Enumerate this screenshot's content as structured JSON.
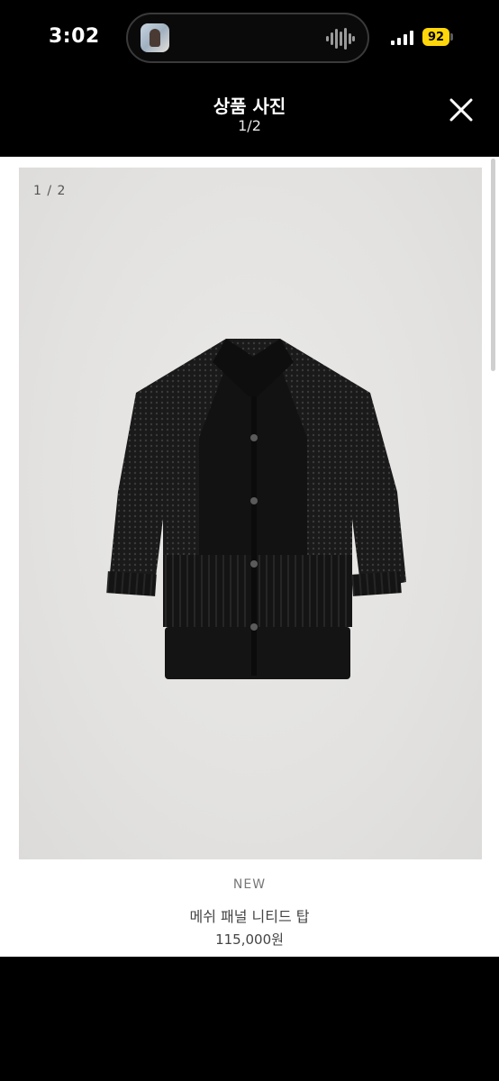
{
  "status_bar": {
    "time": "3:02",
    "battery_level": "92",
    "battery_color": "#ffd60a",
    "icons": [
      "avatar-thumbnail",
      "waveform-icon",
      "signal-icon",
      "battery-icon"
    ]
  },
  "header": {
    "title": "상품 사진",
    "counter": "1/2",
    "close_icon": "close-icon"
  },
  "photo": {
    "counter": "1 / 2",
    "subject": "black knit short-sleeve cardigan"
  },
  "product": {
    "tag": "NEW",
    "name": "메쉬 패널 니티드 탑",
    "price": "115,000원"
  },
  "colors": {
    "background": "#000000",
    "panel": "#ffffff",
    "photo_bg": "#e3e2e0",
    "garment": "#121212"
  }
}
